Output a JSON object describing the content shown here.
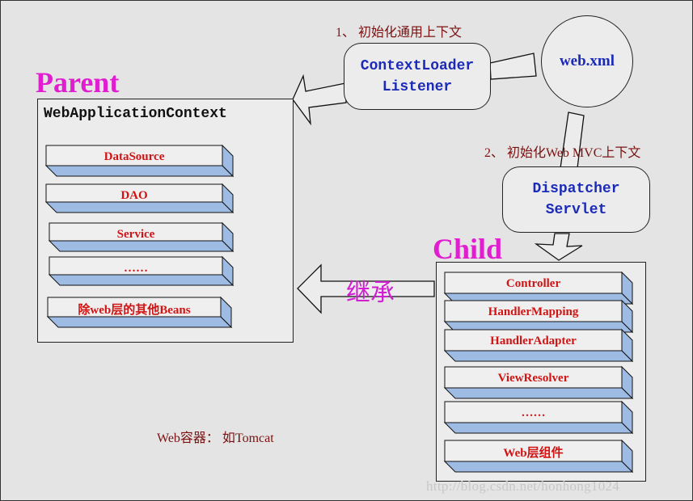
{
  "diagram": {
    "title_parent": "Parent",
    "title_child": "Child",
    "step1_label": "1、 初始化通用上下文",
    "step2_label": "2、 初始化Web MVC上下文",
    "web_xml": "web.xml",
    "context_loader_listener": [
      "ContextLoader",
      "Listener"
    ],
    "dispatcher_servlet": [
      "Dispatcher",
      "Servlet"
    ],
    "inherit_label": "继承",
    "container_label": "Web容器： 如Tomcat",
    "watermark": "http://blog.csdn.net/honhong1024",
    "parent_context": {
      "title": "WebApplicationContext",
      "beans": [
        "DataSource",
        "DAO",
        "Service",
        "……",
        "除web层的其他Beans"
      ]
    },
    "child_context": {
      "beans": [
        "Controller",
        "HandlerMapping",
        "HandlerAdapter",
        "ViewResolver",
        "……",
        "Web层组件"
      ]
    },
    "colors": {
      "background": "#e4e4e4",
      "box_fill": "#ececec",
      "bean_shadow": "#9dbbe3",
      "bean_text": "#d01414",
      "title_magenta": "#e01ed0",
      "node_text_blue": "#1c2ab8",
      "step_text": "#7a1010"
    }
  }
}
